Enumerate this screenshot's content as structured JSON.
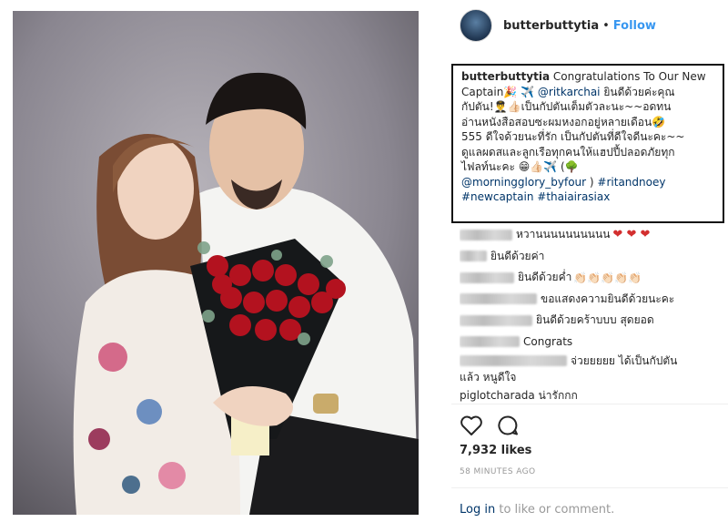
{
  "post": {
    "username": "butterbuttytia",
    "separator": "•",
    "follow_label": "Follow"
  },
  "caption": {
    "username": "butterbuttytia",
    "line1_text": "Congratulations To Our New",
    "line2_text": "Captain",
    "line2_emoji": "🎉 ✈️",
    "line2_mention": "@ritkarchai",
    "line2_rest": "ยินดีด้วยค่ะคุณ",
    "line3": "กัปตัน!👨‍✈️👍🏻เป็นกัปตันเต็มตัวละนะ~~อดทน",
    "line4": "อ่านหนังสือสอบซะผมหงอกอยู่หลายเดือน🤣",
    "line5": "555 ดีใจด้วยนะที่รัก เป็นกัปตันที่ดีใจดีนะคะ~~",
    "line6": "ดูแลผดสและลูกเรือทุกคนให้แฮปปี้ปลอดภัยทุก",
    "line7": "ไฟลท์นะคะ 😁👍🏻✈️ (🌳",
    "line8_mention": "@morningglory_byfour",
    "line8_rest": ")",
    "line8_tag": "#ritandnoey",
    "line9_tag1": "#newcaptain",
    "line9_tag2": "#thaiairasiax"
  },
  "comments": [
    {
      "text": "หวานนนนนนนนนน",
      "suffix": "❤ ❤ ❤"
    },
    {
      "text": "ยินดีด้วยค่า",
      "suffix": ""
    },
    {
      "text": "ยินดีด้วยค่ำ",
      "suffix": "👏🏻👏🏻👏🏻👏🏻👏🏻"
    },
    {
      "text": "ขอแสดงความยินดีด้วยนะคะ",
      "suffix": ""
    },
    {
      "text": "ยินดีด้วยคร้าบบบ สุดยอด",
      "suffix": ""
    },
    {
      "text": "Congrats",
      "suffix": ""
    },
    {
      "text": "จ่วยยยยย ได้เป็นกัปตัน",
      "text2": "แล้ว หนูดีใจ"
    },
    {
      "text": "piglotcharada น่ารักกก",
      "suffix": ""
    }
  ],
  "likes": "7,932 likes",
  "time": "58 MINUTES AGO",
  "login": {
    "link": "Log in",
    "rest": "to like or comment."
  },
  "icons": {
    "like": "heart-outline-icon",
    "comment": "comment-bubble-icon"
  },
  "colors": {
    "link_blue": "#3897f0",
    "hashtag": "#003569",
    "heart": "#d32f2f"
  }
}
